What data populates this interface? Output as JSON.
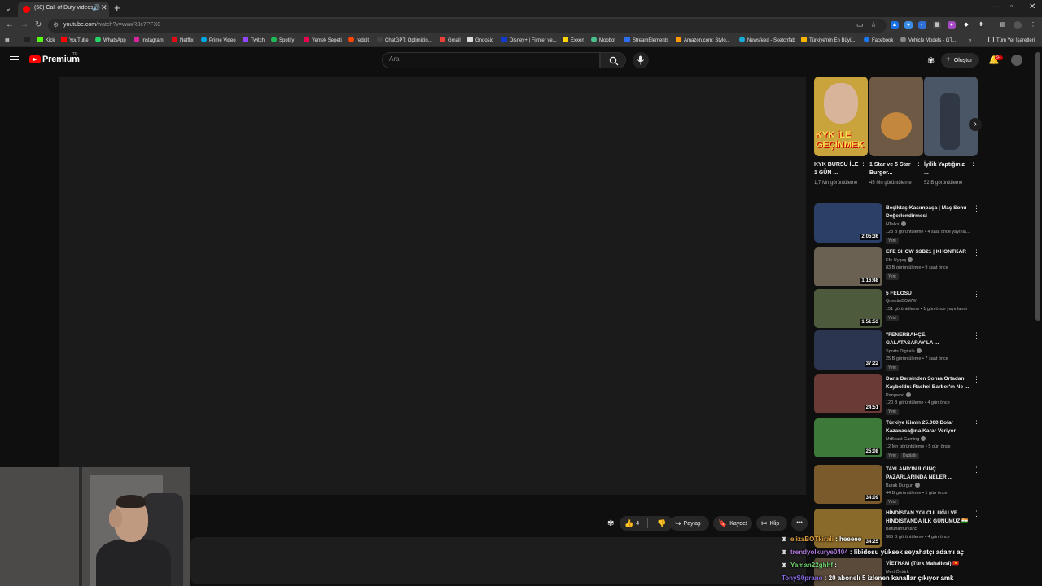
{
  "browser": {
    "tab_title": "(58) Call of Duty videosu 2",
    "url_host": "youtube.com",
    "url_path": "/watch?v=vwwR8c7PFX0",
    "bookmarks": [
      "Kick",
      "YouTube",
      "WhatsApp",
      "Instagram",
      "Netflix",
      "Prime Video",
      "Twitch",
      "Spotify",
      "Yemek Sepeti",
      "reddit",
      "ChatGPT: Optimizin...",
      "Gmail",
      "Gnoosic",
      "Disney+ | Filmler ve...",
      "Exxen",
      "Moobot",
      "StreamElements",
      "Amazon.com: Stylo...",
      "Newsfeed - Sketchfab",
      "Türkiye'nin En Büyü...",
      "Facebook",
      "Vehicle Models - GT..."
    ],
    "all_bookmarks": "Tüm Yer İşaretleri"
  },
  "masthead": {
    "brand": "Premium",
    "region": "TR",
    "search_placeholder": "Ara",
    "create_label": "Oluştur",
    "notif_count": "9+"
  },
  "actions": {
    "like_count": "4",
    "share_label": "Paylaş",
    "save_label": "Kaydet",
    "clip_label": "Klip"
  },
  "shorts": [
    {
      "title": "KYK BURSU İLE 1 GÜN ...",
      "views": "1,7 Mn görüntüleme",
      "thumb_color": "#c9a33c",
      "overlay": "KYK İLE GEÇİNMEK"
    },
    {
      "title": "1 Star ve 5 Star Burger...",
      "views": "45 Mn görüntüleme",
      "thumb_color": "#6e5a44",
      "overlay": ""
    },
    {
      "title": "İyilik Yaptığınız ...",
      "views": "52 B görüntüleme",
      "thumb_color": "#4a5566",
      "overlay": ""
    }
  ],
  "recommended": [
    {
      "title": "Beşiktaş-Kasımpaşa | Maç Sonu Değerlendirmesi",
      "channel": "HTalks",
      "meta": "128 B görüntüleme • 4 saat önce yayınla...",
      "duration": "2:05:36",
      "badge": "Yeni",
      "thumb_color": "#2c3f66",
      "verified": true
    },
    {
      "title": "EFE SHOW S3B21 | KHONTKAR",
      "channel": "Efe Uygaç",
      "meta": "83 B görüntüleme • 9 saat önce",
      "duration": "1:16:48",
      "badge": "Yeni",
      "thumb_color": "#6b6152",
      "verified": true
    },
    {
      "title": "5 FELOSU",
      "channel": "QuentinBOWW",
      "meta": "151 görüntüleme • 1 gün önce yayınlandı",
      "duration": "1:51:53",
      "badge": "Yeni",
      "thumb_color": "#4d5a3c",
      "verified": false
    },
    {
      "title": "\"FENERBAHÇE, GALATASARAY'LA ...",
      "channel": "Sports Digitale",
      "meta": "25 B görüntüleme • 7 saat önce",
      "duration": "37:22",
      "badge": "Yeni",
      "thumb_color": "#2b3550",
      "verified": true
    },
    {
      "title": "Dans Dersinden Sonra Ortadan Kayboldu: Rachel Barber'ın Ne ...",
      "channel": "Pangwoo",
      "meta": "120 B görüntüleme • 4 gün önce",
      "duration": "24:51",
      "badge": "Yeni",
      "thumb_color": "#6a3a36",
      "verified": true
    },
    {
      "title": "Türkiye Kimin 25.000 Dolar Kazanacağına Karar Veriyor",
      "channel": "MrBeast Gaming",
      "meta": "12 Mn görüntüleme • 5 gün önce",
      "duration": "25:08",
      "badge": "Yeni",
      "badge2": "Dublajlı",
      "thumb_color": "#3d7a3a",
      "verified": true
    },
    {
      "title": "TAYLAND'IN İLGİNÇ PAZARLARINDA NELER ...",
      "channel": "Burak Durgun",
      "meta": "44 B görüntüleme • 1 gün önce",
      "duration": "34:09",
      "badge": "Yeni",
      "thumb_color": "#7a5a2a",
      "verified": true
    },
    {
      "title": "HİNDİSTAN YOLCULUĞU VE HİNDİSTANDA İLK GÜNÜMÜZ 🇮🇳",
      "channel": "Batuhanfurkan5",
      "meta": "365 B görüntüleme • 4 gün önce",
      "duration": "34:25",
      "badge": "",
      "thumb_color": "#8a6a2a",
      "verified": false
    },
    {
      "title": "VİETNAM (Türk Mahallesi) 🇻🇳",
      "channel": "Mert Öztürk",
      "meta": "",
      "duration": "",
      "badge": "",
      "thumb_color": "#5a4a3a",
      "verified": false
    }
  ],
  "chat": [
    {
      "user": "elizaBOTkirali",
      "message": " : heeeee",
      "color": "#e0a040"
    },
    {
      "user": "trendyolkurye0404",
      "message": " : libidosu yüksek seyahatçı adamı aç",
      "color": "#b07ae0"
    },
    {
      "user": "Yaman22ghhf",
      "message": " : ",
      "color": "#70d070"
    },
    {
      "user": "TonyS0prano",
      "message": " : 20 abonelı 5 izlenen kanallar çıkıyor amk",
      "color": "#8a6ae6"
    }
  ]
}
